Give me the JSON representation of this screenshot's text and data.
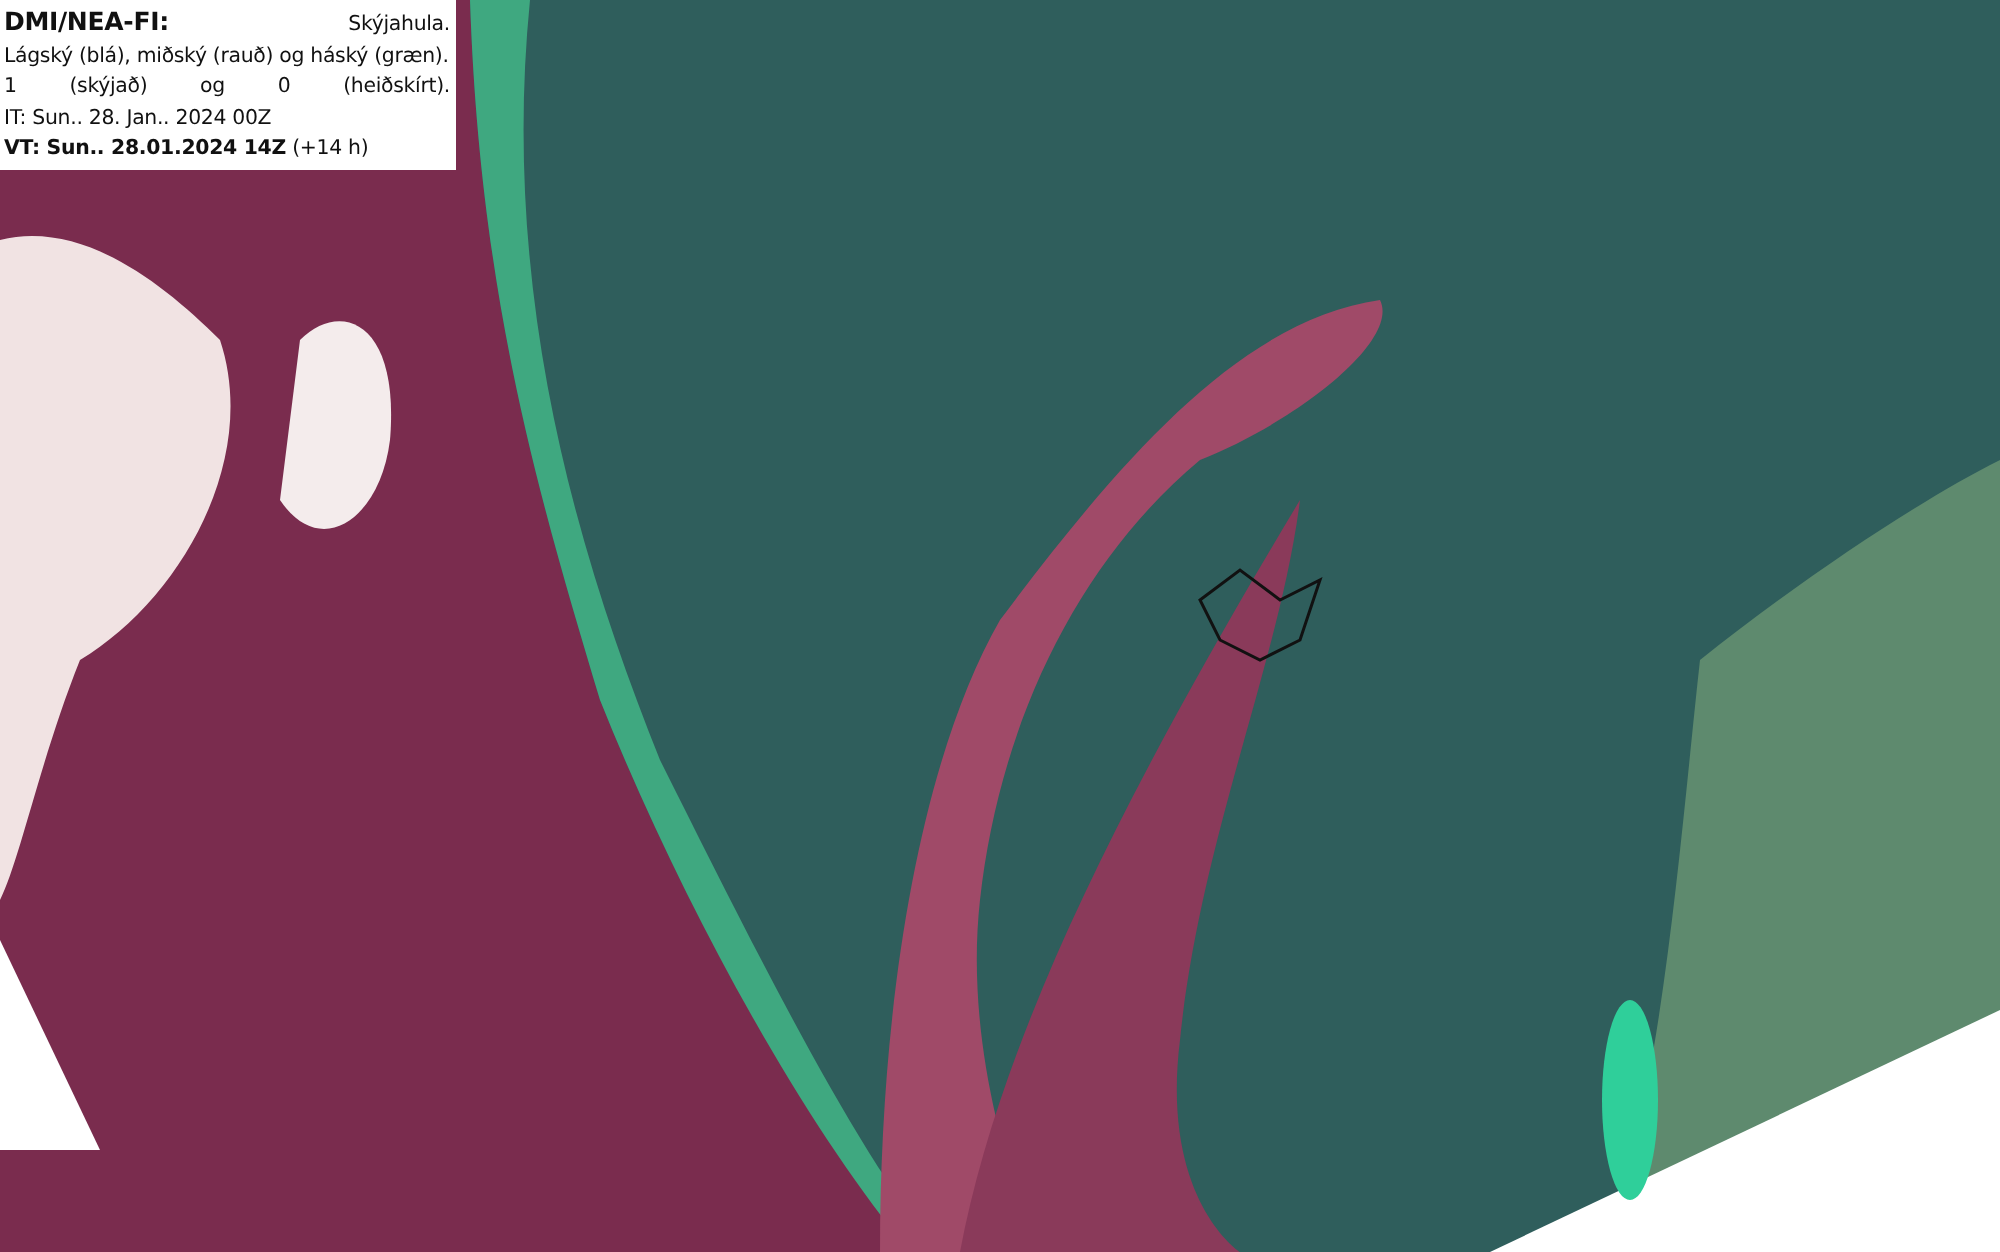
{
  "legend": {
    "source": "DMI/NEA-FI:",
    "title": "Skýjahula.",
    "description": "Lágský (blá), miðský (rauð) og háský (græn).",
    "scale_line": "1 (skýjað) og 0 (heiðskírt).",
    "issue_time": "IT: Sun.. 28. Jan.. 2024 00Z",
    "valid_time": "**VT: Sun.. 28.01.2024 14Z** (+14 h)"
  }
}
